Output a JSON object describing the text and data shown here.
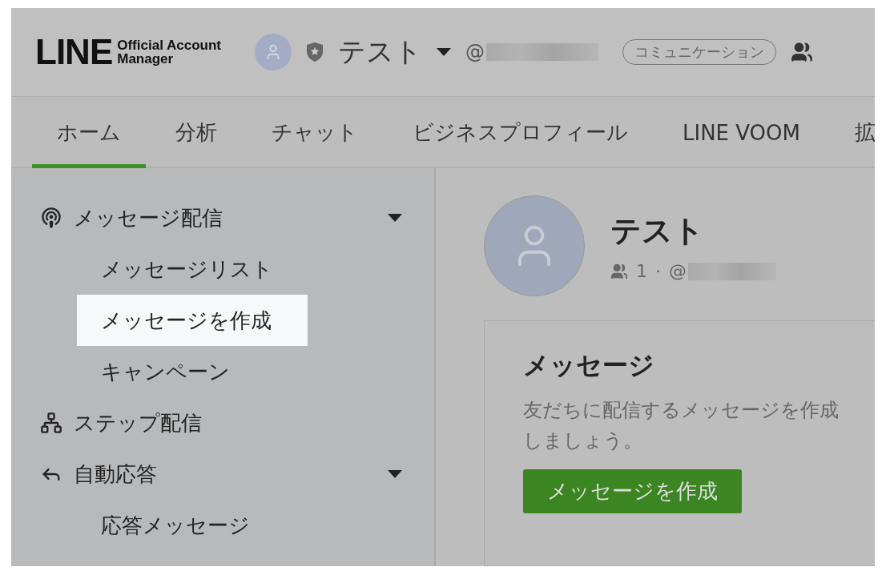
{
  "header": {
    "logo": {
      "brand": "LINE",
      "line_1": "Official Account",
      "line_2": "Manager"
    },
    "account_name": "テスト",
    "account_id_prefix": "@",
    "category_badge": "コミュニケーション"
  },
  "tabs": [
    {
      "label": "ホーム",
      "selected": true
    },
    {
      "label": "分析",
      "selected": false
    },
    {
      "label": "チャット",
      "selected": false
    },
    {
      "label": "ビジネスプロフィール",
      "selected": false
    },
    {
      "label": "LINE VOOM",
      "selected": false
    },
    {
      "label": "拡",
      "selected": false
    }
  ],
  "sidebar": {
    "sections": [
      {
        "label": "メッセージ配信",
        "expanded": true,
        "children": [
          {
            "label": "メッセージリスト",
            "selected": false
          },
          {
            "label": "メッセージを作成",
            "selected": true
          },
          {
            "label": "キャンペーン",
            "selected": false
          }
        ]
      },
      {
        "label": "ステップ配信"
      },
      {
        "label": "自動応答",
        "expanded": true,
        "children": [
          {
            "label": "応答メッセージ",
            "selected": false
          }
        ]
      }
    ]
  },
  "profile": {
    "name": "テスト",
    "friend_count": "1",
    "separator": "·",
    "id_prefix": "@"
  },
  "message_card": {
    "title": "メッセージ",
    "description": "友だちに配信するメッセージを作成しましょう。",
    "button": "メッセージを作成"
  }
}
